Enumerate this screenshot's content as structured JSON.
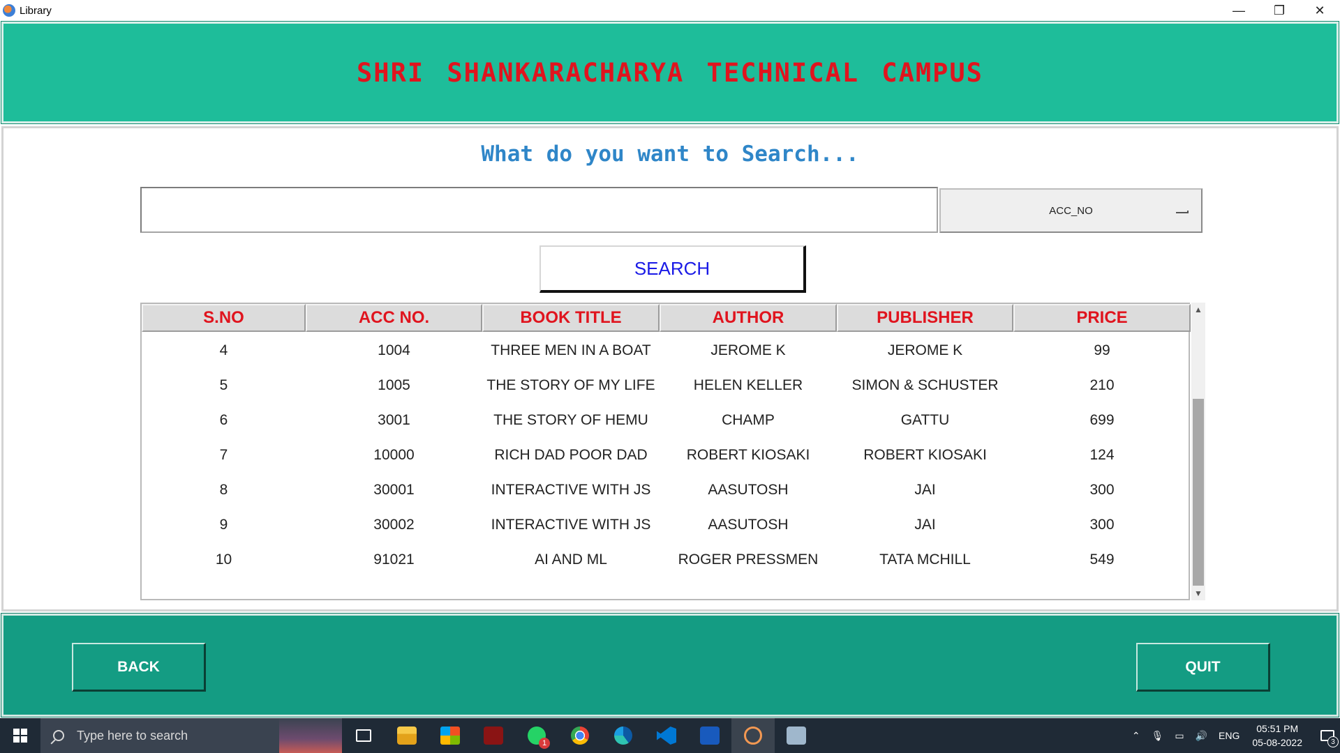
{
  "window": {
    "title": "Library",
    "controls": {
      "minimize": "—",
      "maximize": "❐",
      "close": "✕"
    }
  },
  "header": {
    "title": "SHRI SHANKARACHARYA TECHNICAL CAMPUS"
  },
  "search": {
    "prompt": "What do you want to Search...",
    "input_value": "",
    "placeholder": "",
    "field_selected": "ACC_NO",
    "button_label": "SEARCH"
  },
  "table": {
    "columns": [
      "S.NO",
      "ACC NO.",
      "BOOK TITLE",
      "AUTHOR",
      "PUBLISHER",
      "PRICE"
    ],
    "rows": [
      [
        "4",
        "1004",
        "THREE MEN IN A BOAT",
        "JEROME K",
        "JEROME K",
        "99"
      ],
      [
        "5",
        "1005",
        "THE STORY OF MY LIFE",
        "HELEN KELLER",
        "SIMON & SCHUSTER",
        "210"
      ],
      [
        "6",
        "3001",
        "THE STORY OF HEMU",
        "CHAMP",
        "GATTU",
        "699"
      ],
      [
        "7",
        "10000",
        "RICH DAD POOR DAD",
        "ROBERT KIOSAKI",
        "ROBERT KIOSAKI",
        "124"
      ],
      [
        "8",
        "30001",
        "INTERACTIVE WITH JS",
        "AASUTOSH",
        "JAI",
        "300"
      ],
      [
        "9",
        "30002",
        "INTERACTIVE WITH JS",
        "AASUTOSH",
        "JAI",
        "300"
      ],
      [
        "10",
        "91021",
        "AI AND ML",
        "ROGER PRESSMEN",
        "TATA MCHILL",
        "549"
      ]
    ]
  },
  "footer": {
    "back_label": "BACK",
    "quit_label": "QUIT"
  },
  "taskbar": {
    "search_placeholder": "Type here to search",
    "whatsapp_badge": "1",
    "tray": {
      "language": "ENG",
      "time": "05:51 PM",
      "date": "05-08-2022",
      "notification_count": "3"
    },
    "icons": [
      "task-view-icon",
      "file-explorer-icon",
      "microsoft-store-icon",
      "app-red-icon",
      "whatsapp-icon",
      "chrome-icon",
      "edge-icon",
      "vscode-icon",
      "word-icon",
      "eclipse-icon",
      "photos-icon"
    ]
  },
  "colors": {
    "header_bg": "#1ebd9a",
    "header_text": "#e0141e",
    "prompt_text": "#2f86c8",
    "search_button_text": "#1a1ae6",
    "table_header_text": "#e0141e",
    "footer_bg": "#149c83"
  }
}
